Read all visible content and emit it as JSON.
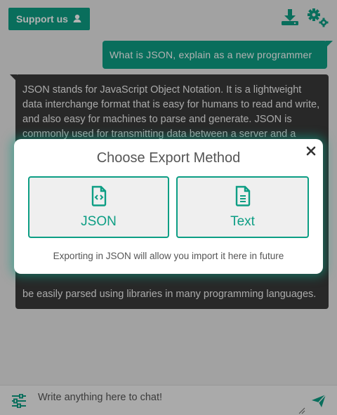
{
  "header": {
    "support_label": "Support us"
  },
  "chat": {
    "user_message": "What is JSON, explain as a new programmer",
    "bot_message_top": "JSON stands for JavaScript Object Notation. It is a lightweight data interchange format that is easy for humans to read and write, and also easy for machines to parse and generate. JSON is commonly used for transmitting data between a server and a",
    "bot_message_bottom": "be easily parsed using libraries in many programming languages."
  },
  "composer": {
    "placeholder": "Write anything here to chat!"
  },
  "modal": {
    "title": "Choose Export Method",
    "options": [
      {
        "label": "JSON",
        "icon": "file-code-icon"
      },
      {
        "label": "Text",
        "icon": "file-text-icon"
      }
    ],
    "note": "Exporting in JSON will allow you import it here in future"
  },
  "colors": {
    "accent": "#0d9e84",
    "bot_bubble": "#3a3a3a",
    "overlay": "rgba(0,0,0,0.30)"
  }
}
